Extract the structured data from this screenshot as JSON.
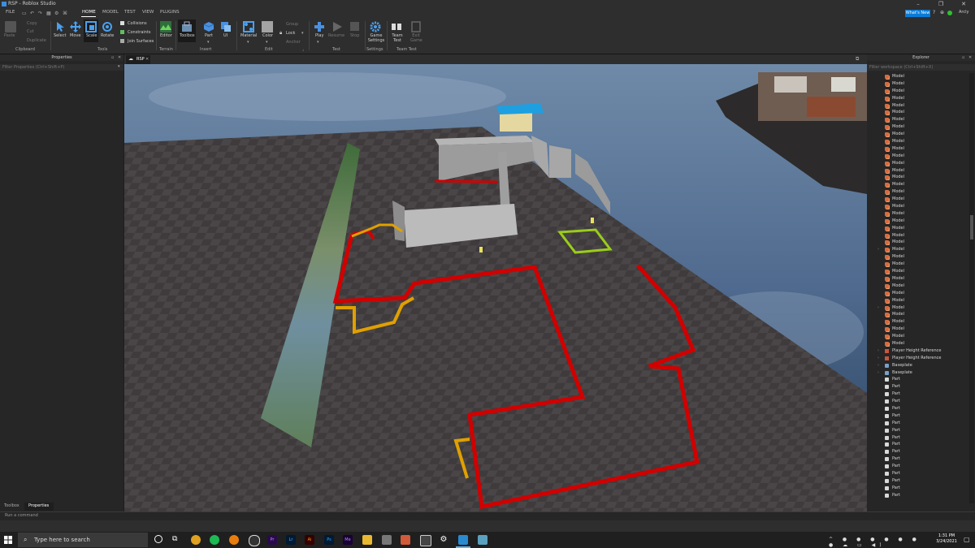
{
  "window": {
    "title": "RSP - Roblox Studio",
    "account": "Arcly"
  },
  "menu": {
    "file": "FILE",
    "tabs": [
      "HOME",
      "MODEL",
      "TEST",
      "VIEW",
      "PLUGINS"
    ],
    "active_tab": "HOME",
    "whats_new": "What's New"
  },
  "ribbon": {
    "clipboard": {
      "paste": "Paste",
      "copy": "Copy",
      "cut": "Cut",
      "duplicate": "Duplicate",
      "group": "Clipboard"
    },
    "tools": {
      "select": "Select",
      "move": "Move",
      "scale": "Scale",
      "rotate": "Rotate",
      "collisions": "Collisions",
      "constraints": "Constraints",
      "join_surfaces": "Join Surfaces",
      "group": "Tools"
    },
    "terrain": {
      "editor": "Editor",
      "group": "Terrain"
    },
    "insert": {
      "toolbox": "Toolbox",
      "part": "Part",
      "ui": "UI",
      "group": "Insert"
    },
    "edit": {
      "material": "Material",
      "color": "Color",
      "group_btn": "Group",
      "lock": "Lock",
      "anchor": "Anchor",
      "group": "Edit"
    },
    "test": {
      "play": "Play",
      "resume": "Resume",
      "stop": "Stop",
      "group": "Test"
    },
    "settings": {
      "game_settings": "Game Settings",
      "group": "Settings"
    },
    "team_test": {
      "team_test": "Team Test",
      "exit_game": "Exit Game",
      "group": "Team Test"
    }
  },
  "properties": {
    "title": "Properties",
    "filter_placeholder": "Filter Properties (Ctrl+Shift+P)"
  },
  "viewport": {
    "tab": "RSP"
  },
  "explorer": {
    "title": "Explorer",
    "filter_placeholder": "Filter workspace (Ctrl+Shift+X)",
    "items": [
      {
        "label": "Model",
        "type": "model",
        "expandable": false
      },
      {
        "label": "Model",
        "type": "model",
        "expandable": false
      },
      {
        "label": "Model",
        "type": "model",
        "expandable": false
      },
      {
        "label": "Model",
        "type": "model",
        "expandable": false
      },
      {
        "label": "Model",
        "type": "model",
        "expandable": false
      },
      {
        "label": "Model",
        "type": "model",
        "expandable": false
      },
      {
        "label": "Model",
        "type": "model",
        "expandable": false
      },
      {
        "label": "Model",
        "type": "model",
        "expandable": false
      },
      {
        "label": "Model",
        "type": "model",
        "expandable": false
      },
      {
        "label": "Model",
        "type": "model",
        "expandable": false
      },
      {
        "label": "Model",
        "type": "model",
        "expandable": false
      },
      {
        "label": "Model",
        "type": "model",
        "expandable": false
      },
      {
        "label": "Model",
        "type": "model",
        "expandable": false
      },
      {
        "label": "Model",
        "type": "model",
        "expandable": false
      },
      {
        "label": "Model",
        "type": "model",
        "expandable": false
      },
      {
        "label": "Model",
        "type": "model",
        "expandable": false
      },
      {
        "label": "Model",
        "type": "model",
        "expandable": false
      },
      {
        "label": "Model",
        "type": "model",
        "expandable": false
      },
      {
        "label": "Model",
        "type": "model",
        "expandable": false
      },
      {
        "label": "Model",
        "type": "model",
        "expandable": false
      },
      {
        "label": "Model",
        "type": "model",
        "expandable": false
      },
      {
        "label": "Model",
        "type": "model",
        "expandable": false
      },
      {
        "label": "Model",
        "type": "model",
        "expandable": false
      },
      {
        "label": "Model",
        "type": "model",
        "expandable": false
      },
      {
        "label": "Model",
        "type": "model",
        "expandable": true
      },
      {
        "label": "Model",
        "type": "model",
        "expandable": false
      },
      {
        "label": "Model",
        "type": "model",
        "expandable": false
      },
      {
        "label": "Model",
        "type": "model",
        "expandable": false
      },
      {
        "label": "Model",
        "type": "model",
        "expandable": false
      },
      {
        "label": "Model",
        "type": "model",
        "expandable": false
      },
      {
        "label": "Model",
        "type": "model",
        "expandable": false
      },
      {
        "label": "Model",
        "type": "model",
        "expandable": false
      },
      {
        "label": "Model",
        "type": "model",
        "expandable": true
      },
      {
        "label": "Model",
        "type": "model",
        "expandable": false
      },
      {
        "label": "Model",
        "type": "model",
        "expandable": false
      },
      {
        "label": "Model",
        "type": "model",
        "expandable": false
      },
      {
        "label": "Model",
        "type": "model",
        "expandable": false
      },
      {
        "label": "Model",
        "type": "model",
        "expandable": false
      },
      {
        "label": "Player Height Reference",
        "type": "player",
        "expandable": true
      },
      {
        "label": "Player Height Reference",
        "type": "player",
        "expandable": true
      },
      {
        "label": "Baseplate",
        "type": "base",
        "expandable": true
      },
      {
        "label": "Baseplate",
        "type": "base",
        "expandable": true
      },
      {
        "label": "Part",
        "type": "part",
        "expandable": false
      },
      {
        "label": "Part",
        "type": "part",
        "expandable": false
      },
      {
        "label": "Part",
        "type": "part",
        "expandable": false
      },
      {
        "label": "Part",
        "type": "part",
        "expandable": false
      },
      {
        "label": "Part",
        "type": "part",
        "expandable": false
      },
      {
        "label": "Part",
        "type": "part",
        "expandable": false
      },
      {
        "label": "Part",
        "type": "part",
        "expandable": false
      },
      {
        "label": "Part",
        "type": "part",
        "expandable": false
      },
      {
        "label": "Part",
        "type": "part",
        "expandable": false
      },
      {
        "label": "Part",
        "type": "part",
        "expandable": false
      },
      {
        "label": "Part",
        "type": "part",
        "expandable": false
      },
      {
        "label": "Part",
        "type": "part",
        "expandable": false
      },
      {
        "label": "Part",
        "type": "part",
        "expandable": false
      },
      {
        "label": "Part",
        "type": "part",
        "expandable": false
      },
      {
        "label": "Part",
        "type": "part",
        "expandable": false
      },
      {
        "label": "Part",
        "type": "part",
        "expandable": false
      },
      {
        "label": "Part",
        "type": "part",
        "expandable": false
      }
    ]
  },
  "bottom_tabs": {
    "toolbox": "Toolbox",
    "properties": "Properties"
  },
  "command_bar": {
    "placeholder": "Run a command"
  },
  "taskbar": {
    "search_placeholder": "Type here to search",
    "time": "1:31 PM",
    "date": "3/24/2021"
  },
  "colors": {
    "accent": "#0a7bd6",
    "outline_red": "#d10000",
    "outline_orange": "#e0a000",
    "outline_green": "#9acd1a"
  }
}
